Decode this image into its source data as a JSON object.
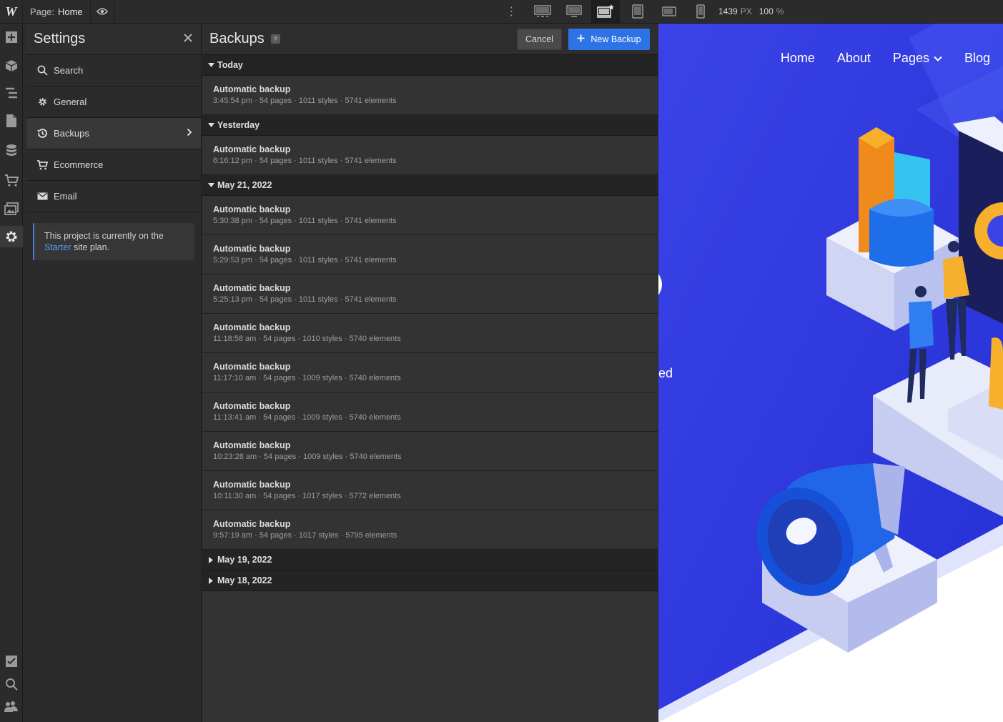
{
  "topbar": {
    "logo": "W",
    "page_prefix": "Page:",
    "page_name": "Home",
    "width_value": "1439",
    "width_unit": "PX",
    "zoom_value": "100",
    "zoom_unit": "%"
  },
  "settings": {
    "title": "Settings",
    "items": [
      {
        "label": "Search"
      },
      {
        "label": "General"
      },
      {
        "label": "Backups"
      },
      {
        "label": "Ecommerce"
      },
      {
        "label": "Email"
      }
    ],
    "plan_note_before": "This project is currently on the",
    "plan_note_link": "Starter",
    "plan_note_after": "site plan."
  },
  "backups": {
    "title": "Backups",
    "help": "?",
    "cancel_label": "Cancel",
    "new_label": "New Backup",
    "groups": [
      {
        "label": "Today",
        "expanded": true,
        "rows": [
          {
            "name": "Automatic backup",
            "meta": "3:45:54 pm · 54 pages · 1011 styles · 5741 elements"
          }
        ]
      },
      {
        "label": "Yesterday",
        "expanded": true,
        "rows": [
          {
            "name": "Automatic backup",
            "meta": "6:16:12 pm · 54 pages · 1011 styles · 5741 elements"
          }
        ]
      },
      {
        "label": "May 21, 2022",
        "expanded": true,
        "rows": [
          {
            "name": "Automatic backup",
            "meta": "5:30:38 pm · 54 pages · 1011 styles · 5741 elements"
          },
          {
            "name": "Automatic backup",
            "meta": "5:29:53 pm · 54 pages · 1011 styles · 5741 elements"
          },
          {
            "name": "Automatic backup",
            "meta": "5:25:13 pm · 54 pages · 1011 styles · 5741 elements"
          },
          {
            "name": "Automatic backup",
            "meta": "11:18:58 am · 54 pages · 1010 styles · 5740 elements"
          },
          {
            "name": "Automatic backup",
            "meta": "11:17:10 am · 54 pages · 1009 styles · 5740 elements"
          },
          {
            "name": "Automatic backup",
            "meta": "11:13:41 am · 54 pages · 1009 styles · 5740 elements"
          },
          {
            "name": "Automatic backup",
            "meta": "10:23:28 am · 54 pages · 1009 styles · 5740 elements"
          },
          {
            "name": "Automatic backup",
            "meta": "10:11:30 am · 54 pages · 1017 styles · 5772 elements"
          },
          {
            "name": "Automatic backup",
            "meta": "9:57:19 am · 54 pages · 1017 styles · 5795 elements"
          }
        ]
      },
      {
        "label": "May 19, 2022",
        "expanded": false,
        "rows": []
      },
      {
        "label": "May 18, 2022",
        "expanded": false,
        "rows": []
      }
    ]
  },
  "preview": {
    "nav": [
      "Home",
      "About",
      "Pages",
      "Blog"
    ],
    "fragment_text": "ed",
    "bg_color": "#2b3de0"
  },
  "colors": {
    "accent": "#2d73e6",
    "link": "#5a9cf5"
  }
}
